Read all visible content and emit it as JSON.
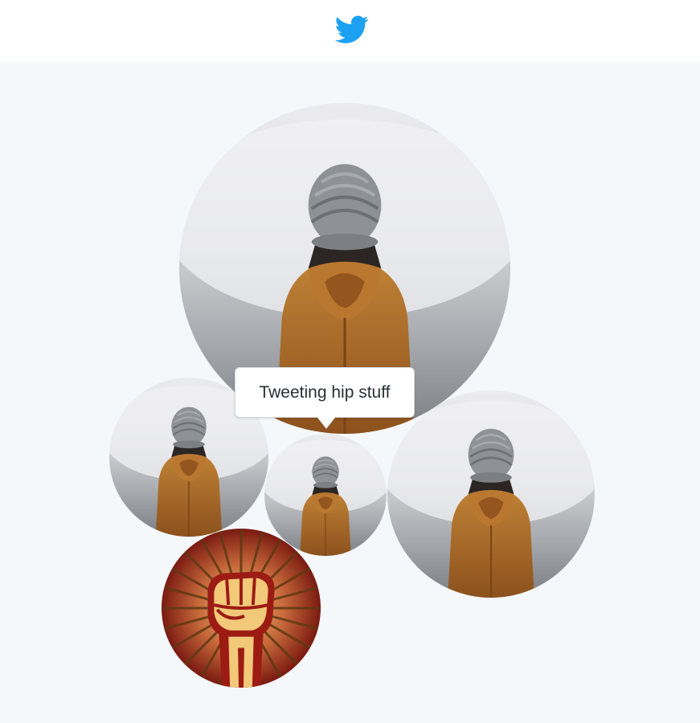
{
  "header": {
    "logo_icon": "twitter-bird-icon",
    "logo_color": "#1da1f2"
  },
  "tooltip": {
    "text": "Tweeting hip stuff"
  },
  "bubbles": [
    {
      "id": "large",
      "avatar": "person-in-beanie-avatar"
    },
    {
      "id": "left",
      "avatar": "person-in-beanie-avatar"
    },
    {
      "id": "center-small",
      "avatar": "person-in-beanie-avatar"
    },
    {
      "id": "right",
      "avatar": "person-in-beanie-avatar"
    },
    {
      "id": "fist",
      "avatar": "raised-fist-avatar"
    }
  ],
  "colors": {
    "background": "#f5f8fa",
    "header_bg": "#ffffff",
    "jacket": "#a8692a",
    "beanie": "#8c8f94",
    "fist_red": "#9c1c14",
    "fist_skin": "#f2c879"
  }
}
